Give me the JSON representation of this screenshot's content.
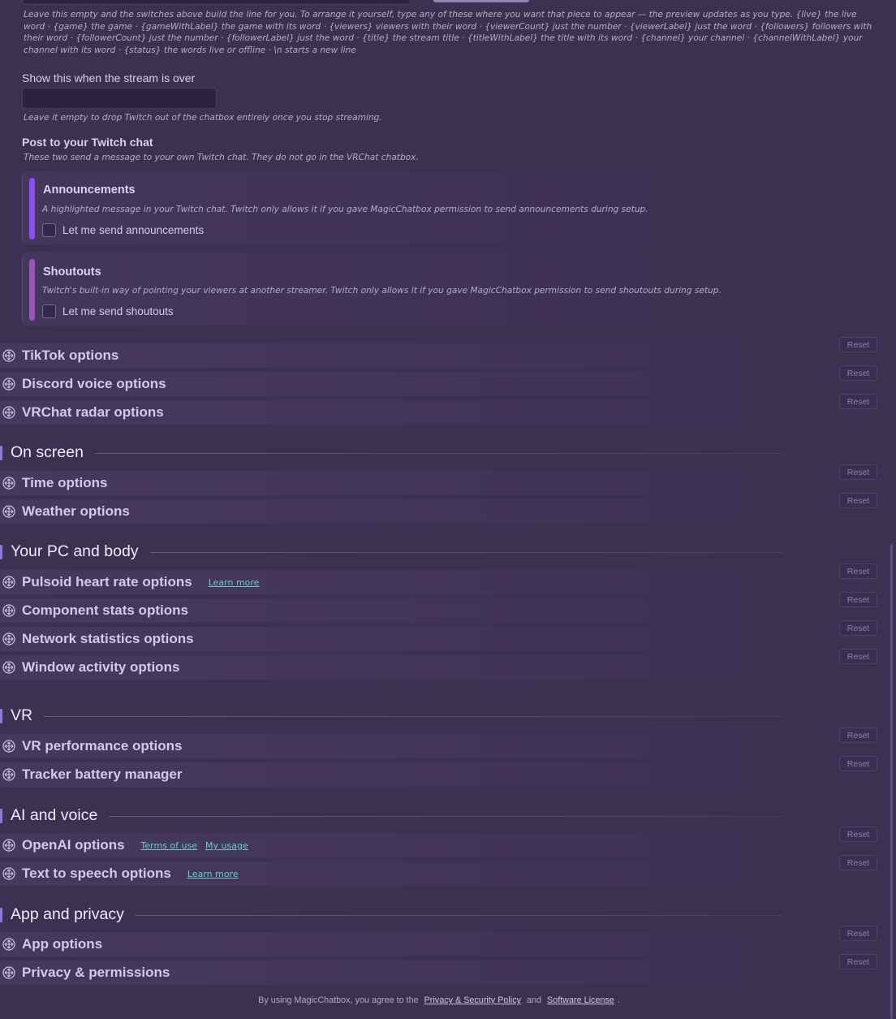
{
  "twitch": {
    "format_hint": "Leave this empty and the switches above build the line for you. To arrange it yourself, type any of these where you want that piece to appear — the preview updates as you type. {live} the live word · {game} the game · {gameWithLabel} the game with its word · {viewers} viewers with their word · {viewerCount} just the number · {viewerLabel} just the word · {followers} followers with their word · {followerCount} just the number · {followerLabel} just the word · {title} the stream title · {titleWithLabel} the title with its word · {channel} your channel · {channelWithLabel} your channel with its word · {status} the words live or offline · \\n starts a new line",
    "offline_label": "Show this when the stream is over",
    "offline_value": "",
    "offline_hint": "Leave it empty to drop Twitch out of the chatbox entirely once you stop streaming.",
    "post_label": "Post to your Twitch chat",
    "post_hint": "These two send a message to your own Twitch chat. They do not go in the VRChat chatbox.",
    "announcements": {
      "title": "Announcements",
      "desc": "A highlighted message in your Twitch chat. Twitch only allows it if you gave MagicChatbox permission to send announcements during setup.",
      "checkbox": "Let me send announcements",
      "checked": false,
      "accent": "#8a4ff0"
    },
    "shoutouts": {
      "title": "Shoutouts",
      "desc": "Twitch's built-in way of pointing your viewers at another streamer. Twitch only allows it if you gave MagicChatbox permission to send shoutouts during setup.",
      "checkbox": "Let me send shoutouts",
      "checked": false,
      "accent": "#9a55b8"
    }
  },
  "reset_label": "Reset",
  "sections_top": [
    {
      "title": "TikTok options",
      "links": []
    },
    {
      "title": "Discord voice options",
      "links": []
    },
    {
      "title": "VRChat radar options",
      "links": []
    }
  ],
  "groups": [
    {
      "title": "On screen",
      "items": [
        {
          "title": "Time options",
          "links": []
        },
        {
          "title": "Weather options",
          "links": []
        }
      ]
    },
    {
      "title": "Your PC and body",
      "items": [
        {
          "title": "Pulsoid heart rate options",
          "links": [
            "Learn more"
          ]
        },
        {
          "title": "Component stats options",
          "links": []
        },
        {
          "title": "Network statistics options",
          "links": []
        },
        {
          "title": "Window activity options",
          "links": []
        }
      ]
    },
    {
      "title": "VR",
      "items": [
        {
          "title": "VR performance options",
          "links": []
        },
        {
          "title": "Tracker battery manager",
          "links": []
        }
      ]
    },
    {
      "title": "AI and voice",
      "items": [
        {
          "title": "OpenAI options",
          "links": [
            "Terms of use",
            "My usage"
          ]
        },
        {
          "title": "Text to speech options",
          "links": [
            "Learn more"
          ]
        }
      ]
    },
    {
      "title": "App and privacy",
      "items": [
        {
          "title": "App options",
          "links": []
        },
        {
          "title": "Privacy & permissions",
          "links": []
        }
      ]
    }
  ],
  "footer": {
    "prefix": "By using MagicChatbox, you agree to the",
    "privacy_link": "Privacy & Security Policy",
    "and": "and",
    "license_link": "Software License",
    "suffix": "."
  },
  "icons": {
    "drag": "move-arrows-icon"
  }
}
